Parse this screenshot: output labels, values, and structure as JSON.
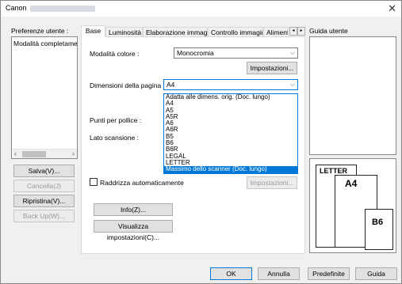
{
  "window": {
    "title": "Canon",
    "close_glyph": "✕"
  },
  "left": {
    "preferences_label": "Preferenze utente :",
    "list_item": "Modalità completamente",
    "save": "Salva(V)...",
    "delete": "Cancella(J)",
    "restore": "Ripristina(V)...",
    "backup": "Back Up(W)..."
  },
  "tabs": [
    "Base",
    "Luminosità",
    "Elaborazione immagine",
    "Controllo immagine",
    "Alimenta"
  ],
  "tab_nav": {
    "left": "◂",
    "right": "▸"
  },
  "basic": {
    "color_mode_label": "Modalità colore :",
    "color_mode_value": "Monocromia",
    "settings_button": "Impostazioni...",
    "page_size_label": "Dimensioni della pagina :",
    "page_size_value": "A4",
    "dpi_label": "Punti per pollice :",
    "scan_side_label": "Lato scansione :",
    "deskew_label": "Raddrizza automaticamente",
    "settings_button_2": "Impostazioni...",
    "info_button": "Info(Z)...",
    "show_settings_button": "Visualizza impostazioni(C)..."
  },
  "page_size_options": [
    "Adatta alle dimens. orig. (Doc. lungo)",
    "A4",
    "A5",
    "A5R",
    "A6",
    "A6R",
    "B5",
    "B6",
    "B6R",
    "LEGAL",
    "LETTER",
    "Massimo dello scanner (Doc. lungo)"
  ],
  "page_size_selected_index": 11,
  "guide": {
    "label": "Guida utente",
    "paper_letter": "LETTER",
    "paper_a4": "A4",
    "paper_b6": "B6"
  },
  "footer": {
    "ok": "OK",
    "cancel": "Annulla",
    "defaults": "Predefinite",
    "help": "Guida"
  },
  "colors": {
    "accent": "#0078d7",
    "window_bg": "#f0f0f0"
  }
}
